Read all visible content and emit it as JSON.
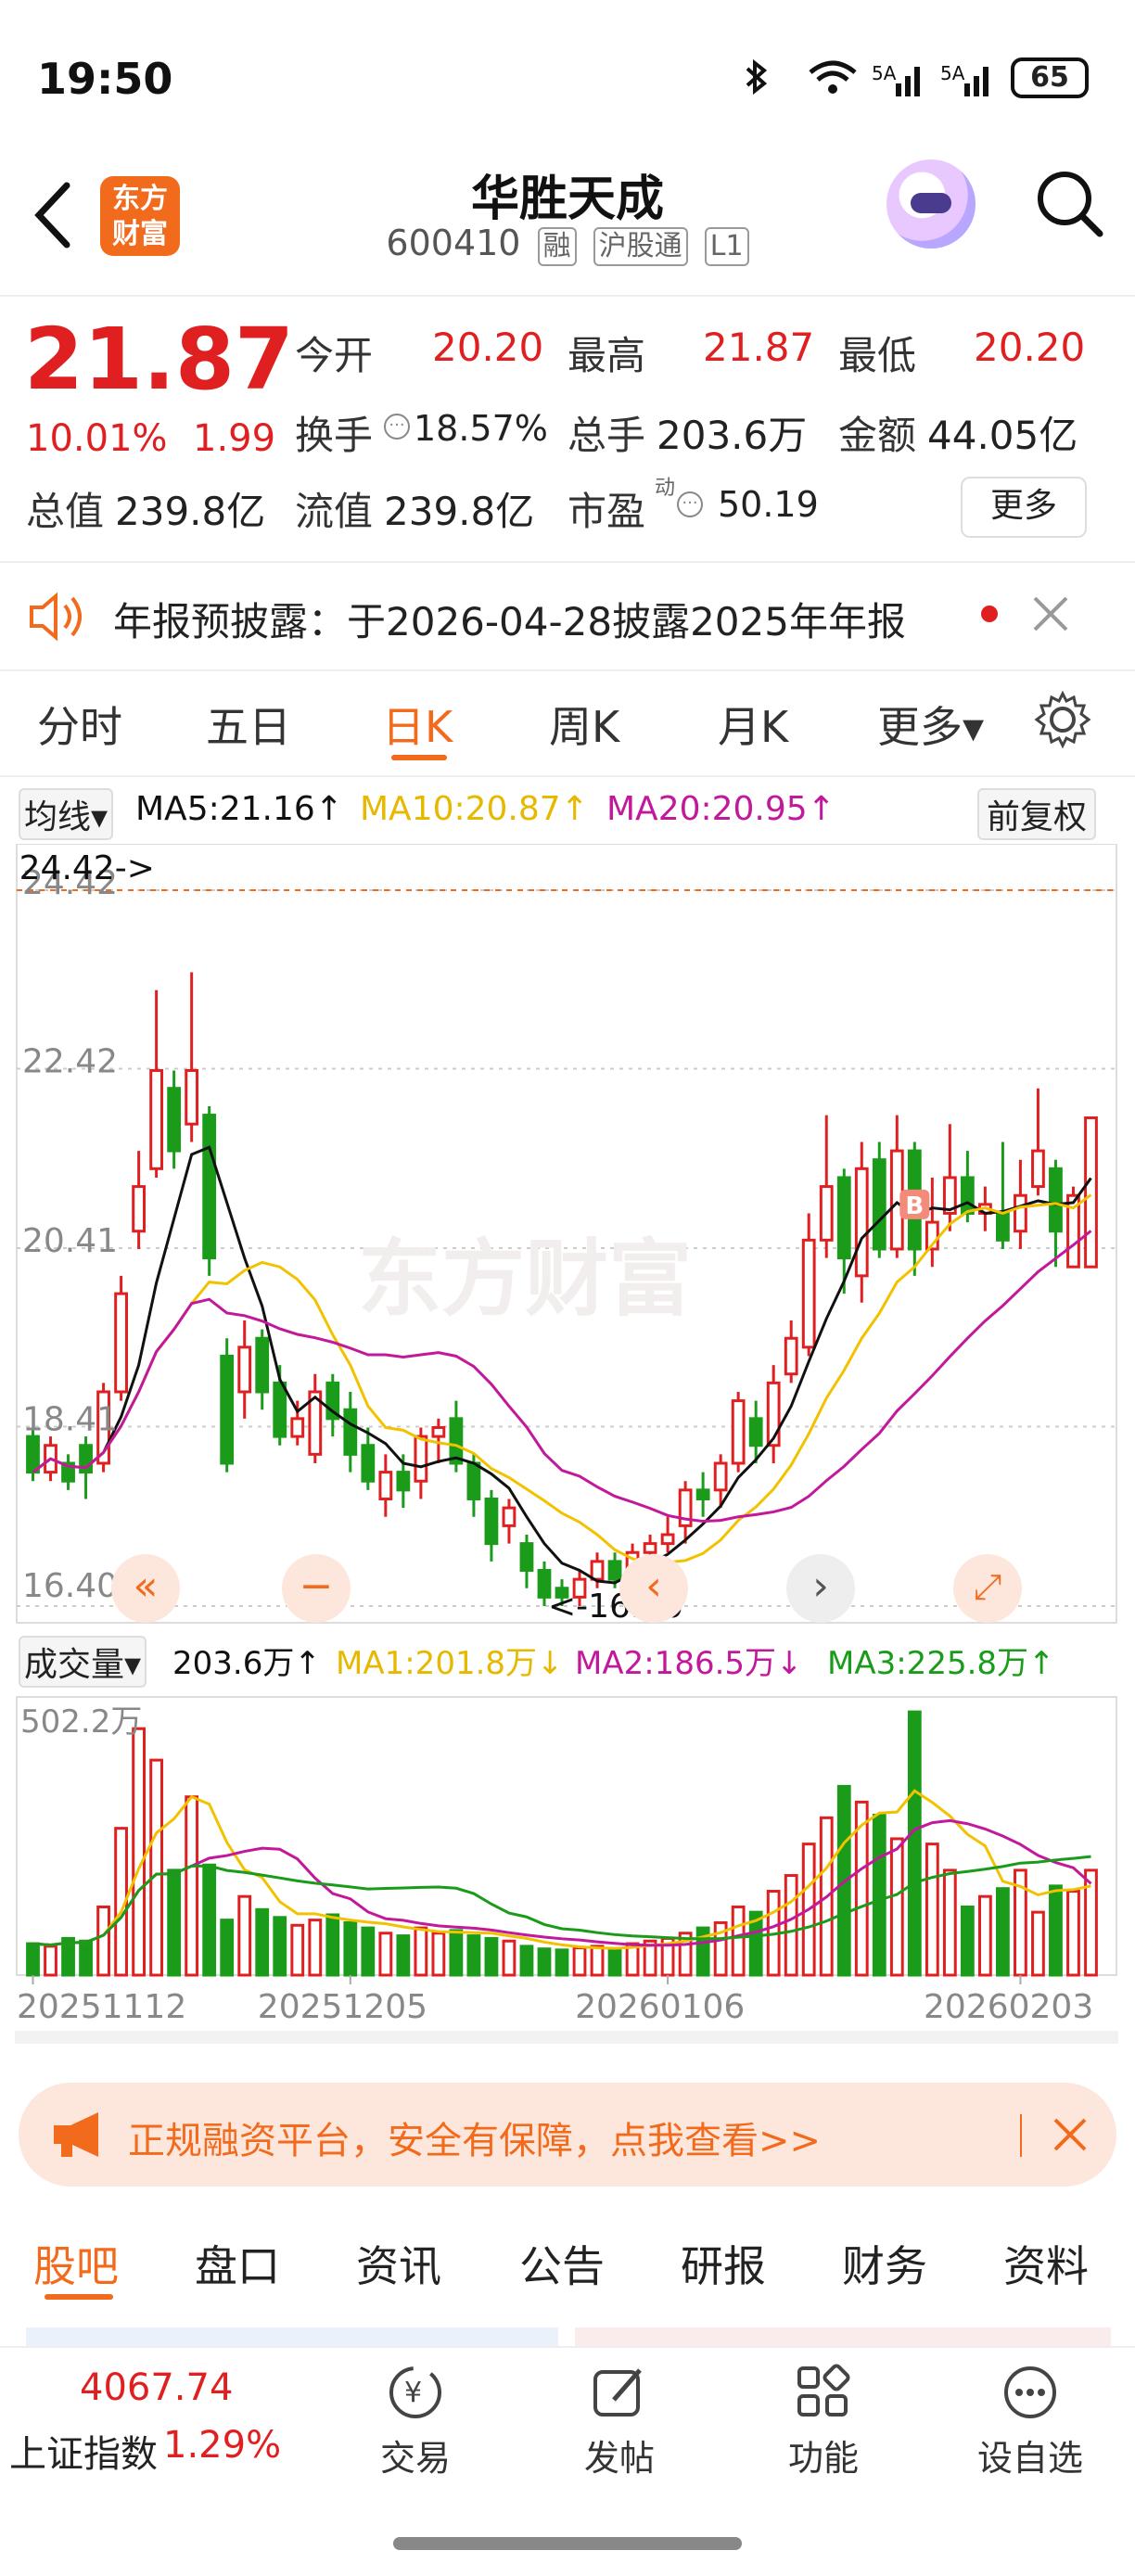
{
  "status": {
    "time": "19:50",
    "battery": "65"
  },
  "header": {
    "logo_text": "东方财富",
    "title": "华胜天成",
    "code": "600410",
    "tags": [
      "融",
      "沪股通",
      "L1"
    ]
  },
  "quote": {
    "price": "21.87",
    "change_pct": "10.01%",
    "change": "1.99",
    "open_label": "今开",
    "open": "20.20",
    "high_label": "最高",
    "high": "21.87",
    "low_label": "最低",
    "low": "20.20",
    "turnover_label": "换手",
    "turnover": "18.57%",
    "volume_label": "总手",
    "volume": "203.6万",
    "amount_label": "金额",
    "amount": "44.05亿",
    "mktcap_label": "总值",
    "mktcap": "239.8亿",
    "float_label": "流值",
    "float": "239.8亿",
    "pe_label": "市盈",
    "pe_sup": "动",
    "pe": "50.19",
    "more": "更多"
  },
  "notice": {
    "text": "年报预披露：于2026-04-28披露2025年年报"
  },
  "chart_tabs": [
    "分时",
    "五日",
    "日K",
    "周K",
    "月K",
    "更多▾"
  ],
  "chart_tab_active": "日K",
  "ma_bar": {
    "selector": "均线▾",
    "ma5": "MA5:21.16↑",
    "ma10": "MA10:20.87↑",
    "ma20": "MA20:20.95↑",
    "adjust": "前复权"
  },
  "vol_bar": {
    "selector": "成交量▾",
    "vol": "203.6万↑",
    "ma1": "MA1:201.8万↓",
    "ma2": "MA2:186.5万↓",
    "ma3": "MA3:225.8万↑"
  },
  "chart_data": {
    "type": "candlestick",
    "y_ticks": [
      "24.42",
      "22.42",
      "20.41",
      "18.41",
      "16.40"
    ],
    "ylim": [
      16.4,
      24.42
    ],
    "max_annotation": "24.42->",
    "min_annotation": "<-16.40",
    "buy_marker": "B",
    "vol_max_label": "502.2万",
    "dates": [
      "20251112",
      "20251205",
      "20260106",
      "20260203"
    ],
    "candles": [
      [
        18.3,
        17.9,
        18.4,
        17.8
      ],
      [
        17.9,
        18.2,
        18.3,
        17.8
      ],
      [
        18.0,
        17.8,
        18.1,
        17.7
      ],
      [
        18.2,
        17.9,
        18.3,
        17.6
      ],
      [
        18.0,
        18.8,
        18.9,
        17.9
      ],
      [
        18.8,
        19.9,
        20.1,
        18.7
      ],
      [
        20.6,
        21.1,
        21.5,
        20.4
      ],
      [
        21.3,
        22.4,
        23.3,
        21.2
      ],
      [
        22.2,
        21.5,
        22.4,
        21.3
      ],
      [
        21.8,
        22.4,
        23.5,
        21.6
      ],
      [
        21.9,
        20.3,
        22.0,
        20.1
      ],
      [
        19.2,
        18.0,
        19.4,
        17.9
      ],
      [
        18.8,
        19.3,
        19.6,
        18.5
      ],
      [
        19.4,
        18.8,
        19.5,
        18.6
      ],
      [
        18.9,
        18.3,
        19.1,
        18.2
      ],
      [
        18.3,
        18.5,
        18.7,
        18.2
      ],
      [
        18.1,
        18.8,
        19.0,
        18.0
      ],
      [
        18.9,
        18.5,
        19.0,
        18.3
      ],
      [
        18.6,
        18.1,
        18.8,
        17.9
      ],
      [
        18.2,
        17.8,
        18.4,
        17.7
      ],
      [
        17.6,
        17.9,
        18.1,
        17.4
      ],
      [
        17.9,
        17.7,
        18.1,
        17.5
      ],
      [
        17.8,
        18.3,
        18.4,
        17.6
      ],
      [
        18.3,
        18.4,
        18.5,
        18.0
      ],
      [
        18.5,
        18.0,
        18.7,
        17.9
      ],
      [
        18.0,
        17.6,
        18.1,
        17.4
      ],
      [
        17.6,
        17.1,
        17.7,
        16.9
      ],
      [
        17.3,
        17.5,
        17.6,
        17.1
      ],
      [
        17.1,
        16.8,
        17.2,
        16.6
      ],
      [
        16.8,
        16.5,
        16.9,
        16.4
      ],
      [
        16.6,
        16.5,
        16.7,
        16.4
      ],
      [
        16.5,
        16.7,
        16.8,
        16.4
      ],
      [
        16.7,
        16.9,
        17.0,
        16.6
      ],
      [
        16.9,
        16.7,
        17.0,
        16.6
      ],
      [
        16.8,
        17.0,
        17.1,
        16.7
      ],
      [
        17.0,
        17.1,
        17.2,
        16.9
      ],
      [
        17.1,
        17.2,
        17.4,
        17.0
      ],
      [
        17.3,
        17.7,
        17.8,
        17.1
      ],
      [
        17.7,
        17.6,
        17.9,
        17.4
      ],
      [
        17.7,
        18.0,
        18.1,
        17.5
      ],
      [
        18.0,
        18.7,
        18.8,
        17.9
      ],
      [
        18.5,
        18.2,
        18.7,
        18.0
      ],
      [
        18.2,
        18.9,
        19.1,
        18.0
      ],
      [
        19.0,
        19.4,
        19.6,
        18.9
      ],
      [
        19.3,
        20.5,
        20.8,
        19.2
      ],
      [
        20.5,
        21.1,
        21.9,
        20.3
      ],
      [
        21.2,
        20.3,
        21.3,
        19.9
      ],
      [
        20.1,
        21.3,
        21.6,
        19.8
      ],
      [
        21.4,
        20.4,
        21.6,
        20.3
      ],
      [
        20.4,
        21.5,
        21.9,
        20.3
      ],
      [
        21.5,
        20.4,
        21.6,
        20.1
      ],
      [
        20.4,
        20.7,
        21.2,
        20.2
      ],
      [
        20.8,
        21.2,
        21.8,
        20.6
      ],
      [
        21.2,
        20.8,
        21.5,
        20.7
      ],
      [
        20.8,
        20.9,
        21.1,
        20.6
      ],
      [
        20.8,
        20.5,
        21.6,
        20.4
      ],
      [
        20.6,
        21.0,
        21.4,
        20.4
      ],
      [
        21.1,
        21.5,
        22.2,
        21.0
      ],
      [
        21.3,
        20.6,
        21.4,
        20.2
      ],
      [
        20.2,
        21.0,
        21.1,
        20.2
      ],
      [
        20.2,
        21.87,
        21.87,
        20.2
      ]
    ],
    "volumes": [
      60,
      55,
      70,
      65,
      130,
      280,
      470,
      410,
      200,
      340,
      210,
      105,
      150,
      125,
      110,
      95,
      105,
      115,
      100,
      90,
      80,
      75,
      90,
      80,
      85,
      75,
      70,
      65,
      55,
      50,
      48,
      52,
      55,
      50,
      60,
      65,
      70,
      80,
      90,
      100,
      130,
      120,
      160,
      190,
      250,
      300,
      360,
      330,
      305,
      260,
      502,
      250,
      200,
      130,
      150,
      165,
      200,
      120,
      170,
      160,
      200
    ]
  },
  "banner": {
    "text": "正规融资平台，安全有保障，点我查看>>"
  },
  "bottom_tabs": [
    "股吧",
    "盘口",
    "资讯",
    "公告",
    "研报",
    "财务",
    "资料"
  ],
  "bottom_tab_active": "股吧",
  "footer": {
    "index_value": "4067.74",
    "index_name": "上证指数",
    "index_change": "1.29%",
    "items": [
      "交易",
      "发帖",
      "功能",
      "设自选"
    ]
  },
  "colors": {
    "up": "#e02020",
    "down": "#1a9b1a",
    "accent": "#f26b1d",
    "ma5": "#111111",
    "ma10": "#f2c200",
    "ma20": "#c2189b"
  }
}
